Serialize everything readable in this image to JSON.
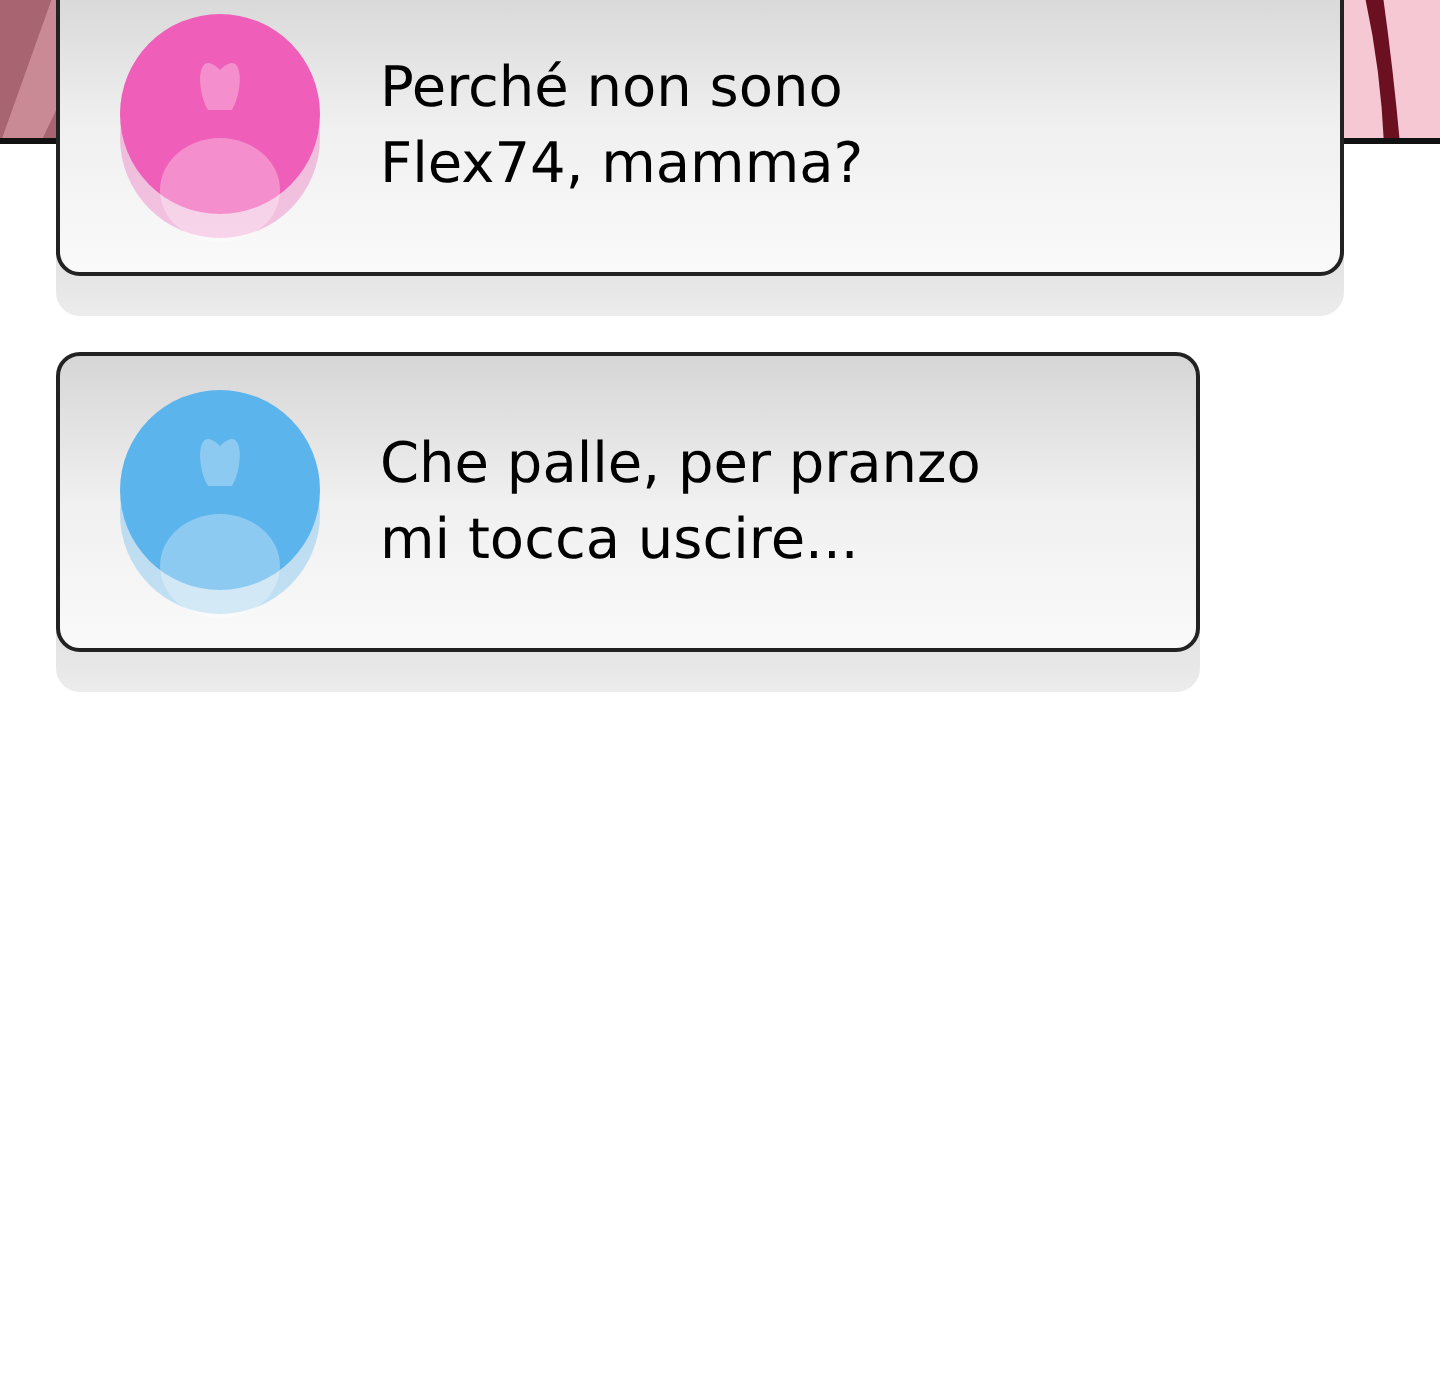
{
  "messages": [
    {
      "text": "Perché non sono\nFlex74, mamma?",
      "color": "#ef5eb8",
      "wide": true
    },
    {
      "text": "Che palle, per pranzo\nmi tocca uscire...",
      "color": "#5cb4ec",
      "wide": false
    }
  ]
}
